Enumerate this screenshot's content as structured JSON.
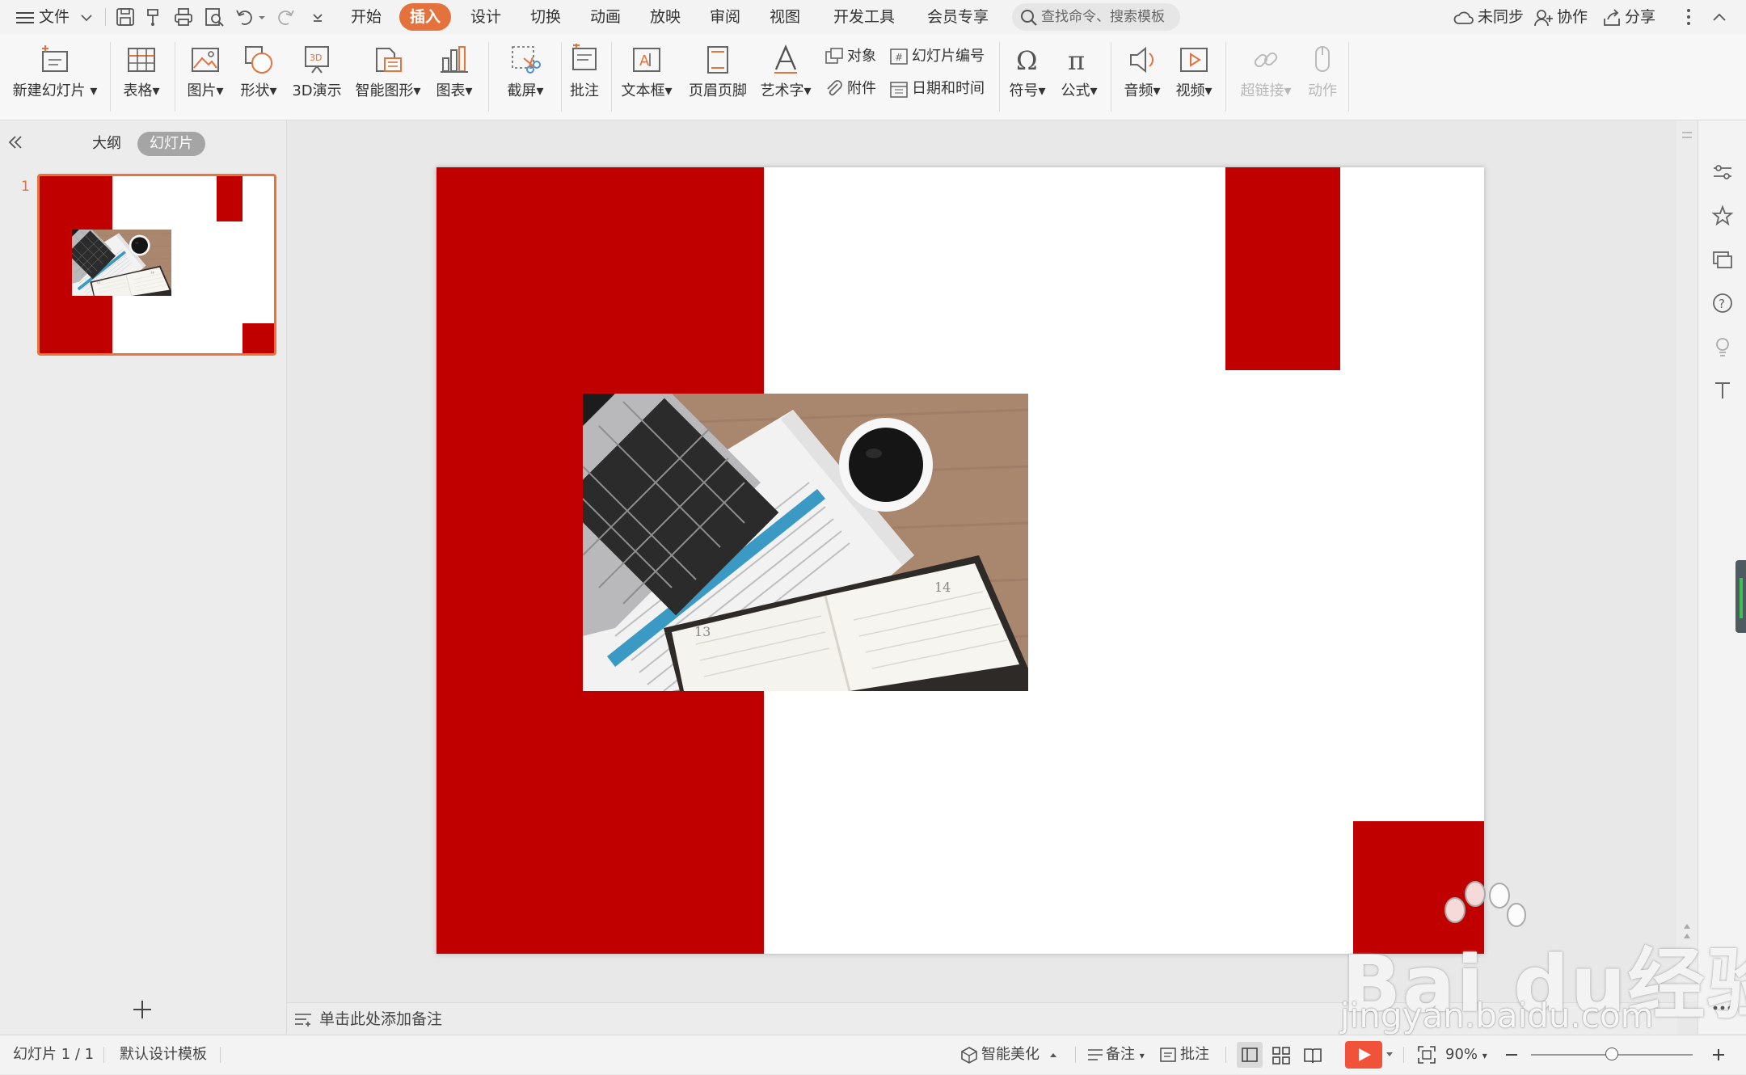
{
  "menubar": {
    "file_label": "文件",
    "tabs": [
      "开始",
      "插入",
      "设计",
      "切换",
      "动画",
      "放映",
      "审阅",
      "视图",
      "开发工具",
      "会员专享"
    ],
    "active_tab": "插入",
    "search_placeholder": "查找命令、搜索模板",
    "sync_label": "未同步",
    "collab_label": "协作",
    "share_label": "分享"
  },
  "ribbon": {
    "new_slide": "新建幻灯片",
    "table": "表格",
    "picture": "图片",
    "shape": "形状",
    "demo3d": "3D演示",
    "smartart": "智能图形",
    "chart": "图表",
    "screenshot": "截屏",
    "comment": "批注",
    "textbox": "文本框",
    "header_footer": "页眉页脚",
    "wordart": "艺术字",
    "object": "对象",
    "slide_number": "幻灯片编号",
    "attachment": "附件",
    "datetime": "日期和时间",
    "symbol": "符号",
    "formula": "公式",
    "audio": "音频",
    "video": "视频",
    "hyperlink": "超链接",
    "action": "动作"
  },
  "left_panel": {
    "outline_tab": "大纲",
    "slides_tab": "幻灯片",
    "slide_index": "1"
  },
  "notes": {
    "placeholder": "单击此处添加备注"
  },
  "status": {
    "slide_counter": "幻灯片 1 / 1",
    "template": "默认设计模板",
    "beautify": "智能美化",
    "notes_btn": "备注",
    "comment_btn": "批注",
    "zoom": "90%",
    "zoom_level": 0.5
  },
  "colors": {
    "accent_orange": "#e3723c",
    "slide_red": "#c00000",
    "play_red": "#f0523a"
  },
  "watermark": {
    "brand": "Bai du经验",
    "url": "jingyan.baidu.com"
  }
}
